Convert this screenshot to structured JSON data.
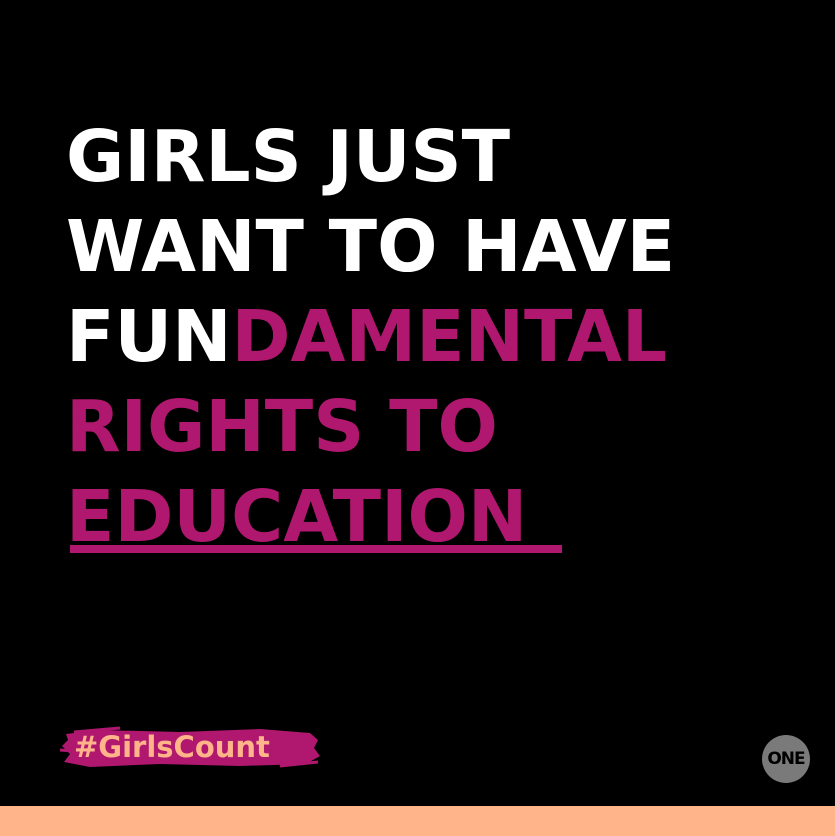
{
  "headline": {
    "line1": "GIRLS JUST",
    "line2": "WANT TO HAVE",
    "line3_white": "FUN",
    "line3_magenta": "DAMENTAL",
    "line4": "RIGHTS TO",
    "line5": "EDUCATION"
  },
  "hashtag": "#GirlsCount",
  "logo": "ONE",
  "colors": {
    "background": "#000000",
    "text_primary": "#FFFFFF",
    "accent": "#B0176E",
    "peach": "#FFB48A",
    "logo_circle": "#7A7A7A"
  }
}
